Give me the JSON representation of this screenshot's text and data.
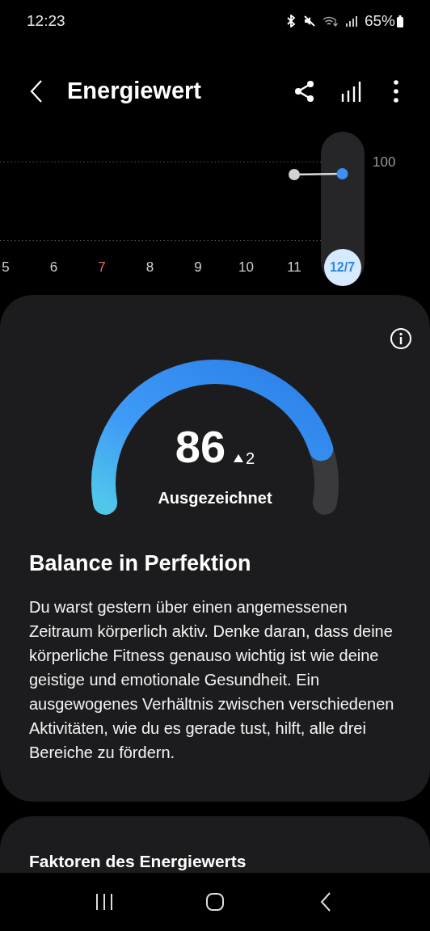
{
  "status_bar": {
    "time": "12:23",
    "battery": "65%"
  },
  "header": {
    "title": "Energiewert"
  },
  "chart": {
    "max_label": "100",
    "days": [
      {
        "label": "5",
        "weekend": false,
        "selected": false
      },
      {
        "label": "6",
        "weekend": false,
        "selected": false
      },
      {
        "label": "7",
        "weekend": true,
        "selected": false
      },
      {
        "label": "8",
        "weekend": false,
        "selected": false
      },
      {
        "label": "9",
        "weekend": false,
        "selected": false
      },
      {
        "label": "10",
        "weekend": false,
        "selected": false
      },
      {
        "label": "11",
        "weekend": false,
        "selected": false
      },
      {
        "label": "12/7",
        "weekend": false,
        "selected": true
      }
    ]
  },
  "score": {
    "value": "86",
    "change": "2",
    "rating": "Ausgezeichnet"
  },
  "summary": {
    "title": "Balance in Perfektion",
    "text": "Du warst gestern über einen angemessenen Zeitraum körperlich aktiv. Denke daran, dass deine körperliche Fitness genauso wichtig ist wie deine geistige und emotionale Gesundheit. Ein ausgewogenes Verhältnis zwischen verschiedenen Aktivitäten, wie du es gerade tust, hilft, alle drei Bereiche zu fördern."
  },
  "factors": {
    "title": "Faktoren des Energiewerts"
  }
}
